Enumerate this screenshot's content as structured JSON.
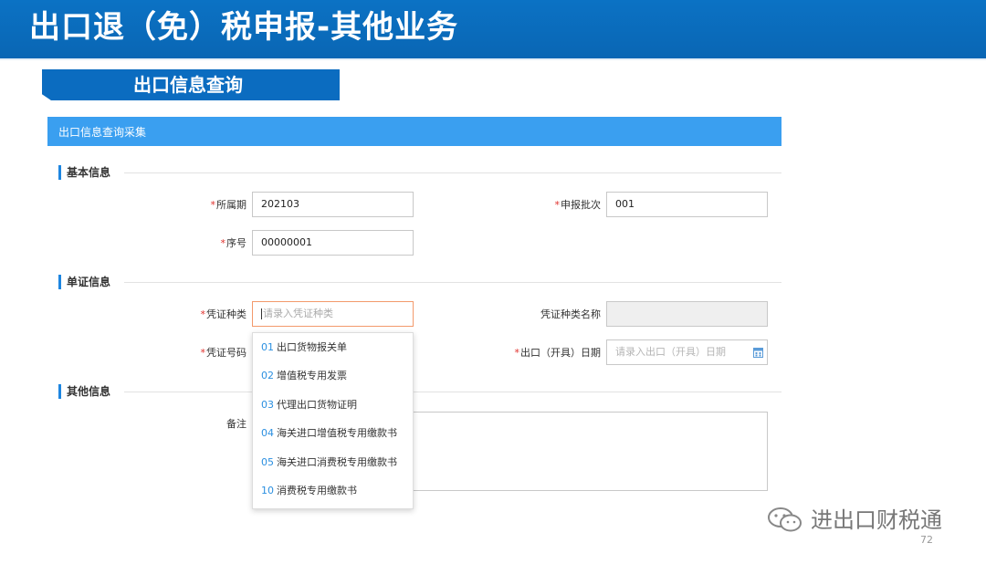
{
  "banner": {
    "title": "出口退（免）税申报-其他业务"
  },
  "section_tab": {
    "label": "出口信息查询"
  },
  "form": {
    "header": "出口信息查询采集",
    "groups": {
      "basic": "基本信息",
      "document": "单证信息",
      "other": "其他信息"
    },
    "required_mark": "*",
    "fields": {
      "period": {
        "label": "所属期",
        "value": "202103"
      },
      "batch": {
        "label": "申报批次",
        "value": "001"
      },
      "serial": {
        "label": "序号",
        "value": "00000001"
      },
      "doc_type": {
        "label": "凭证种类",
        "placeholder": "请录入凭证种类"
      },
      "doc_type_name": {
        "label": "凭证种类名称",
        "value": ""
      },
      "doc_number": {
        "label": "凭证号码"
      },
      "export_date": {
        "label": "出口（开具）日期",
        "placeholder": "请录入出口（开具）日期"
      },
      "remark": {
        "label": "备注"
      }
    },
    "doc_type_options": [
      {
        "code": "01",
        "label": "出口货物报关单"
      },
      {
        "code": "02",
        "label": "增值税专用发票"
      },
      {
        "code": "03",
        "label": "代理出口货物证明"
      },
      {
        "code": "04",
        "label": "海关进口增值税专用缴款书"
      },
      {
        "code": "05",
        "label": "海关进口消费税专用缴款书"
      },
      {
        "code": "10",
        "label": "消费税专用缴款书"
      }
    ]
  },
  "watermark": {
    "text": "进出口财税通"
  },
  "page_number": "72",
  "colors": {
    "banner": "#0b72c4",
    "form_header": "#3a9ff0",
    "required": "#e0302b",
    "focus_border": "#f39a6c",
    "option_code": "#2b8fe0"
  },
  "icons": [
    "calendar-icon",
    "wechat-icon"
  ]
}
